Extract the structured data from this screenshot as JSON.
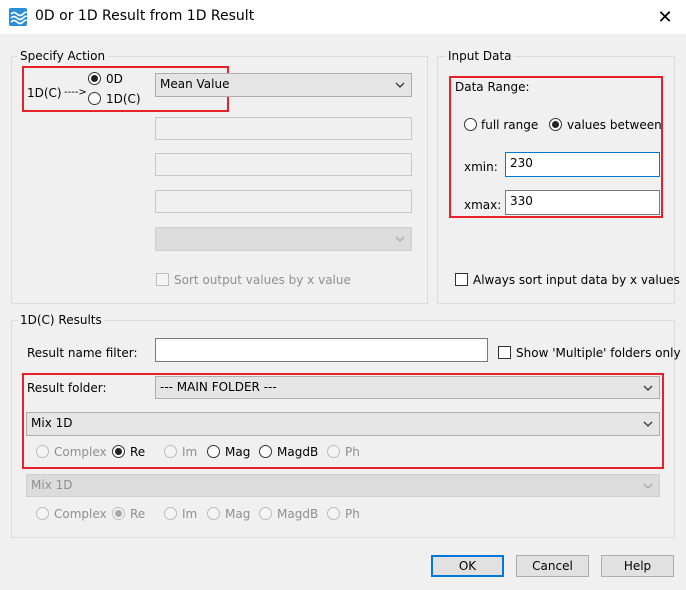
{
  "window": {
    "title": "0D or 1D Result from 1D Result",
    "icon": "wave-icon",
    "close_glyph": "✕"
  },
  "specify_action": {
    "legend": "Specify Action",
    "source_label": "1D(C)",
    "arrow": "---->",
    "target_0d": "0D",
    "target_1dc": "1D(C)",
    "selected_target": "0D",
    "action": "Mean Value",
    "sort_output_label": "Sort output values by x value",
    "sort_output_checked": false
  },
  "input_data": {
    "legend": "Input Data",
    "data_range_label": "Data Range:",
    "full_range_label": "full range",
    "values_between_label": "values between",
    "selected_range": "values between",
    "xmin_label": "xmin:",
    "xmin_value": "230",
    "xmax_label": "xmax:",
    "xmax_value": "330",
    "always_sort_label": "Always sort input data by x values",
    "always_sort_checked": false
  },
  "results": {
    "legend": "1D(C) Results",
    "name_filter_label": "Result name filter:",
    "name_filter_value": "",
    "show_multiple_label": "Show 'Multiple' folders only",
    "show_multiple_checked": false,
    "result_folder_label": "Result folder:",
    "result_folder_value": "--- MAIN FOLDER ---",
    "primary_result": "Mix 1D",
    "primary_component": "Re",
    "secondary_result": "Mix 1D",
    "secondary_component": "Re",
    "components": [
      "Complex",
      "Re",
      "Im",
      "Mag",
      "MagdB",
      "Ph"
    ]
  },
  "buttons": {
    "ok": "OK",
    "cancel": "Cancel",
    "help": "Help"
  },
  "colors": {
    "highlight": "#e8202a",
    "default_button_border": "#0078d7"
  }
}
